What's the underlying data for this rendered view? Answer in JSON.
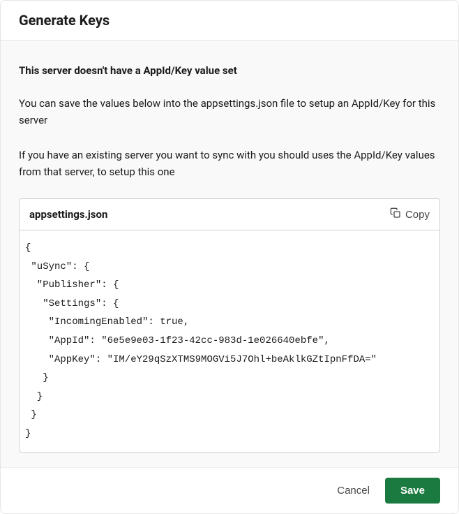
{
  "modal": {
    "title": "Generate Keys",
    "heading": "This server doesn't have a AppId/Key value set",
    "paragraph1": "You can save the values below into the appsettings.json file to setup an AppId/Key for this server",
    "paragraph2": "If you have an existing server you want to sync with you should uses the AppId/Key values from that server, to setup this one",
    "codePanel": {
      "title": "appsettings.json",
      "copyLabel": "Copy",
      "content": "{\n \"uSync\": {\n  \"Publisher\": {\n   \"Settings\": {\n    \"IncomingEnabled\": true,\n    \"AppId\": \"6e5e9e03-1f23-42cc-983d-1e026640ebfe\",\n    \"AppKey\": \"IM/eY29qSzXTMS9MOGVi5J7Ohl+beAklkGZtIpnFfDA=\"\n   }\n  }\n }\n}"
    },
    "footer": {
      "cancelLabel": "Cancel",
      "saveLabel": "Save"
    }
  }
}
